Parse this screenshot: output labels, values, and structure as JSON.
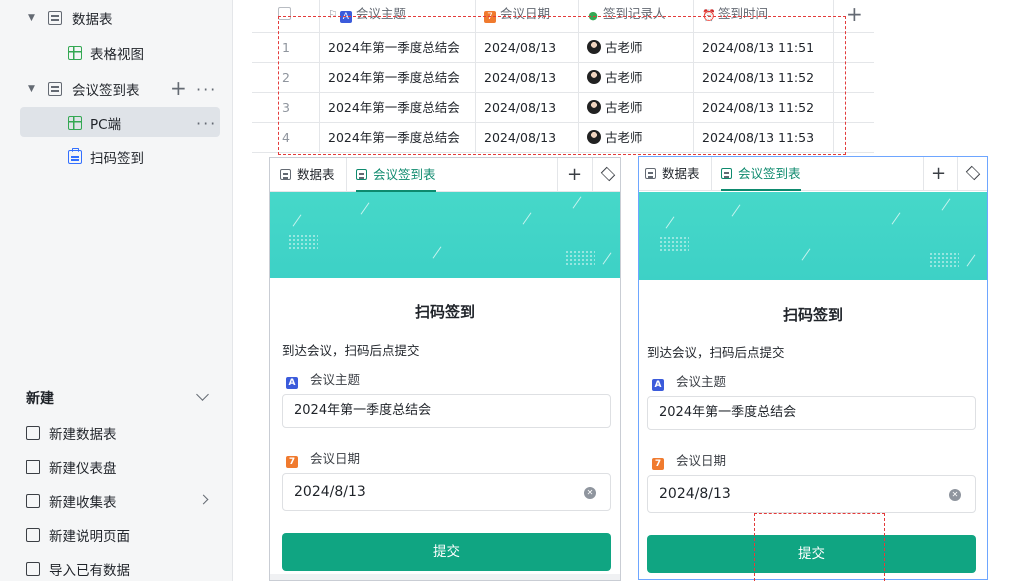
{
  "sidebar": {
    "tree": [
      {
        "label": "数据表",
        "kind": "list",
        "expanded": true
      },
      {
        "label": "表格视图",
        "kind": "grid"
      },
      {
        "label": "会议签到表",
        "kind": "list",
        "expanded": true
      },
      {
        "label": "PC端",
        "kind": "grid",
        "active": true
      },
      {
        "label": "扫码签到",
        "kind": "form"
      }
    ],
    "new_section": {
      "title": "新建",
      "items": [
        {
          "label": "新建数据表"
        },
        {
          "label": "新建仪表盘"
        },
        {
          "label": "新建收集表"
        },
        {
          "label": "新建说明页面"
        },
        {
          "label": "导入已有数据"
        }
      ]
    }
  },
  "table": {
    "columns": [
      {
        "label": "会议主题",
        "icon": "A",
        "color": "#3370ff"
      },
      {
        "label": "会议日期",
        "icon": "7",
        "color": "#f07a2e"
      },
      {
        "label": "签到记录人",
        "icon": "person",
        "color": "#34a853"
      },
      {
        "label": "签到时间",
        "icon": "alarm",
        "color": "#f5a623"
      }
    ],
    "rows": [
      {
        "n": "1",
        "topic": "2024年第一季度总结会",
        "date": "2024/08/13",
        "person": "古老师",
        "time": "2024/08/13 11:51"
      },
      {
        "n": "2",
        "topic": "2024年第一季度总结会",
        "date": "2024/08/13",
        "person": "古老师",
        "time": "2024/08/13 11:52"
      },
      {
        "n": "3",
        "topic": "2024年第一季度总结会",
        "date": "2024/08/13",
        "person": "古老师",
        "time": "2024/08/13 11:52"
      },
      {
        "n": "4",
        "topic": "2024年第一季度总结会",
        "date": "2024/08/13",
        "person": "古老师",
        "time": "2024/08/13 11:53"
      }
    ]
  },
  "forms": [
    {
      "tabs": [
        "数据表",
        "会议签到表"
      ],
      "title": "扫码签到",
      "desc": "到达会议，扫码后点提交",
      "field1_label": "会议主题",
      "field1_value": "2024年第一季度总结会",
      "field2_label": "会议日期",
      "field2_value": "2024/8/13",
      "submit": "提交"
    },
    {
      "tabs": [
        "数据表",
        "会议签到表"
      ],
      "title": "扫码签到",
      "desc": "到达会议，扫码后点提交",
      "field1_label": "会议主题",
      "field1_value": "2024年第一季度总结会",
      "field2_label": "会议日期",
      "field2_value": "2024/8/13",
      "submit": "提交"
    }
  ],
  "colors": {
    "accent": "#10a582",
    "annotation": "#e33b3b",
    "banner": "#46d8c9"
  }
}
